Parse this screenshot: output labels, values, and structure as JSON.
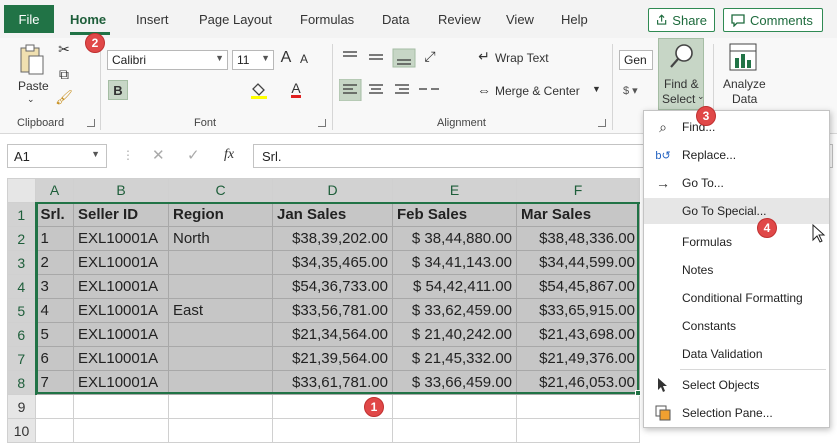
{
  "tabs": [
    {
      "label": "File"
    },
    {
      "label": "Home"
    },
    {
      "label": "Insert"
    },
    {
      "label": "Page Layout"
    },
    {
      "label": "Formulas"
    },
    {
      "label": "Data"
    },
    {
      "label": "Review"
    },
    {
      "label": "View"
    },
    {
      "label": "Help"
    }
  ],
  "share_label": "Share",
  "comments_label": "Comments",
  "ribbon": {
    "clipboard": {
      "paste_label": "Paste",
      "group_label": "Clipboard"
    },
    "font": {
      "name": "Calibri",
      "size": "11",
      "bold_glyph": "B",
      "group_label": "Font",
      "grow_glyph": "A",
      "shrink_glyph": "A",
      "font_color_glyph": "A"
    },
    "alignment": {
      "wrap_text": "Wrap Text",
      "merge_center": "Merge & Center",
      "group_label": "Alignment"
    },
    "number": {
      "format_value": "Gen"
    },
    "editing": {
      "find_select_line1": "Find &",
      "find_select_line2": "Select"
    },
    "analysis": {
      "analyze_line1": "Analyze",
      "analyze_line2": "Data"
    }
  },
  "formula_bar": {
    "name_box": "A1",
    "fx_glyph": "fx",
    "content": "Srl."
  },
  "grid": {
    "columns": [
      "A",
      "B",
      "C",
      "D",
      "E",
      "F"
    ],
    "rows": [
      [
        "Srl.",
        "Seller ID",
        "Region",
        "Jan Sales",
        "Feb Sales",
        "Mar Sales"
      ],
      [
        "1",
        "EXL10001A",
        "North",
        "$38,39,202.00",
        "$ 38,44,880.00",
        "$38,48,336.00"
      ],
      [
        "2",
        "EXL10001A",
        "",
        "$34,35,465.00",
        "$ 34,41,143.00",
        "$34,44,599.00"
      ],
      [
        "3",
        "EXL10001A",
        "",
        "$54,36,733.00",
        "$ 54,42,411.00",
        "$54,45,867.00"
      ],
      [
        "4",
        "EXL10001A",
        "East",
        "$33,56,781.00",
        "$ 33,62,459.00",
        "$33,65,915.00"
      ],
      [
        "5",
        "EXL10001A",
        "",
        "$21,34,564.00",
        "$ 21,40,242.00",
        "$21,43,698.00"
      ],
      [
        "6",
        "EXL10001A",
        "",
        "$21,39,564.00",
        "$ 21,45,332.00",
        "$21,49,376.00"
      ],
      [
        "7",
        "EXL10001A",
        "",
        "$33,61,781.00",
        "$ 33,66,459.00",
        "$21,46,053.00"
      ],
      [
        "",
        "",
        "",
        "",
        "",
        ""
      ],
      [
        "",
        "",
        "",
        "",
        "",
        ""
      ]
    ],
    "row_numbers": [
      "1",
      "2",
      "3",
      "4",
      "5",
      "6",
      "7",
      "8",
      "9",
      "10"
    ]
  },
  "menu": {
    "items": [
      {
        "label": "Find...",
        "icon": "search-icon"
      },
      {
        "label": "Replace...",
        "icon": "replace-icon"
      },
      {
        "label": "Go To...",
        "icon": "arrow-right-icon"
      },
      {
        "label": "Go To Special...",
        "icon": "none"
      },
      {
        "label": "Formulas",
        "icon": "none"
      },
      {
        "label": "Notes",
        "icon": "none"
      },
      {
        "label": "Conditional Formatting",
        "icon": "none"
      },
      {
        "label": "Constants",
        "icon": "none"
      },
      {
        "label": "Data Validation",
        "icon": "none"
      },
      {
        "label": "Select Objects",
        "icon": "cursor-icon"
      },
      {
        "label": "Selection Pane...",
        "icon": "selection-pane-icon"
      }
    ]
  },
  "badges": [
    "1",
    "2",
    "3",
    "4"
  ],
  "colors": {
    "accent": "#217346",
    "badge": "#e04848",
    "selection": "#c6c6c6"
  }
}
